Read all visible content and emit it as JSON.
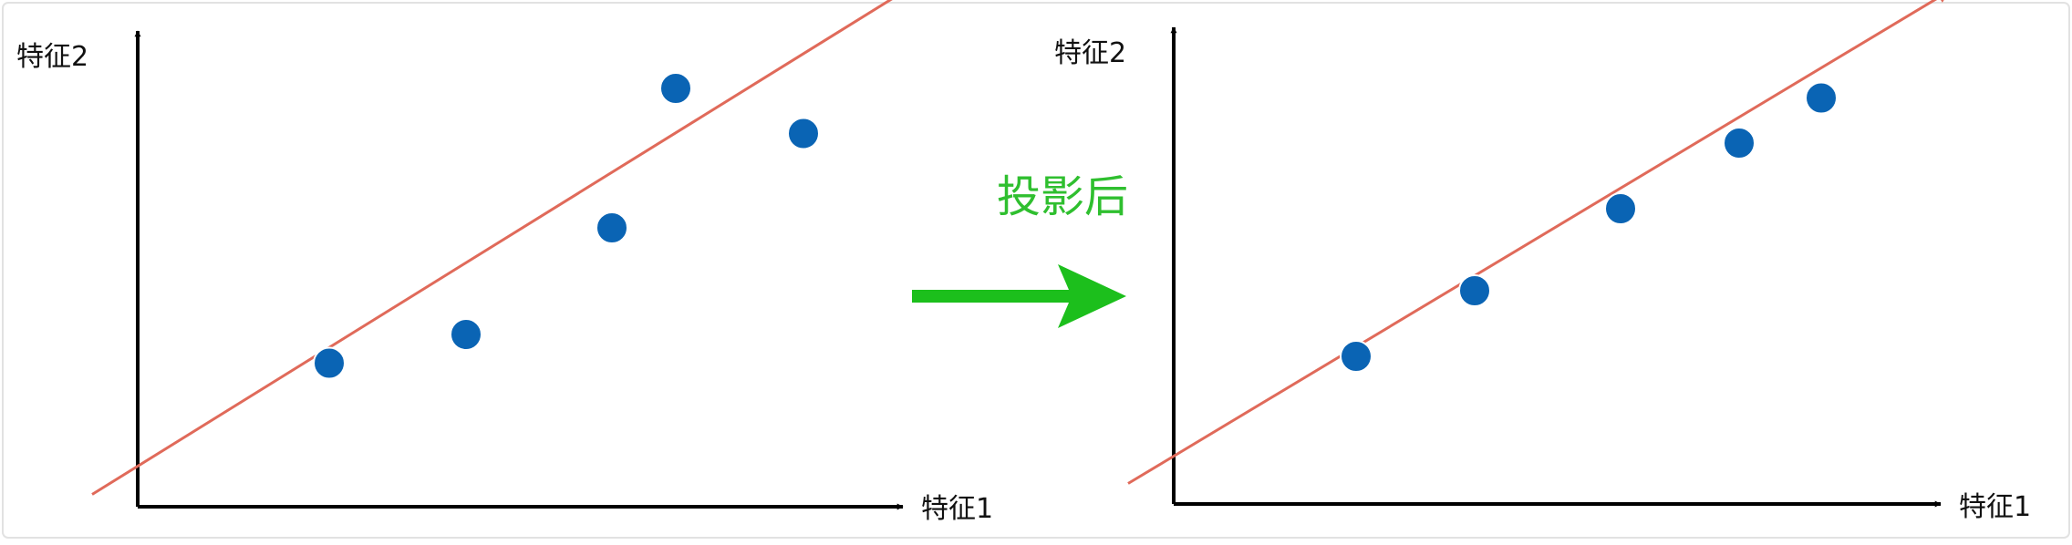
{
  "colors": {
    "axis": "#000000",
    "regression_line": "#e06a5a",
    "point": "#0a64b4",
    "arrow": "#1cbf1c",
    "caption": "#2fbf2f"
  },
  "caption": "投影后",
  "chart_data": [
    {
      "type": "scatter",
      "xlabel": "特征1",
      "ylabel": "特征2",
      "has_fit_line": true,
      "points": [
        {
          "x": 2.1,
          "y": 3.5
        },
        {
          "x": 3.6,
          "y": 4.2
        },
        {
          "x": 5.2,
          "y": 6.8
        },
        {
          "x": 5.9,
          "y": 10.2
        },
        {
          "x": 7.3,
          "y": 9.1
        }
      ],
      "fit_line": {
        "x": [
          -0.5,
          8.5
        ],
        "y": [
          0.3,
          12.7
        ]
      }
    },
    {
      "type": "scatter",
      "xlabel": "特征1",
      "ylabel": "特征2",
      "has_fit_line": true,
      "points": [
        {
          "x": 2.0,
          "y": 3.6
        },
        {
          "x": 3.3,
          "y": 5.2
        },
        {
          "x": 4.9,
          "y": 7.2
        },
        {
          "x": 6.2,
          "y": 8.8
        },
        {
          "x": 7.1,
          "y": 9.9
        }
      ],
      "fit_line": {
        "x": [
          -0.5,
          8.5
        ],
        "y": [
          0.5,
          12.5
        ]
      }
    }
  ]
}
